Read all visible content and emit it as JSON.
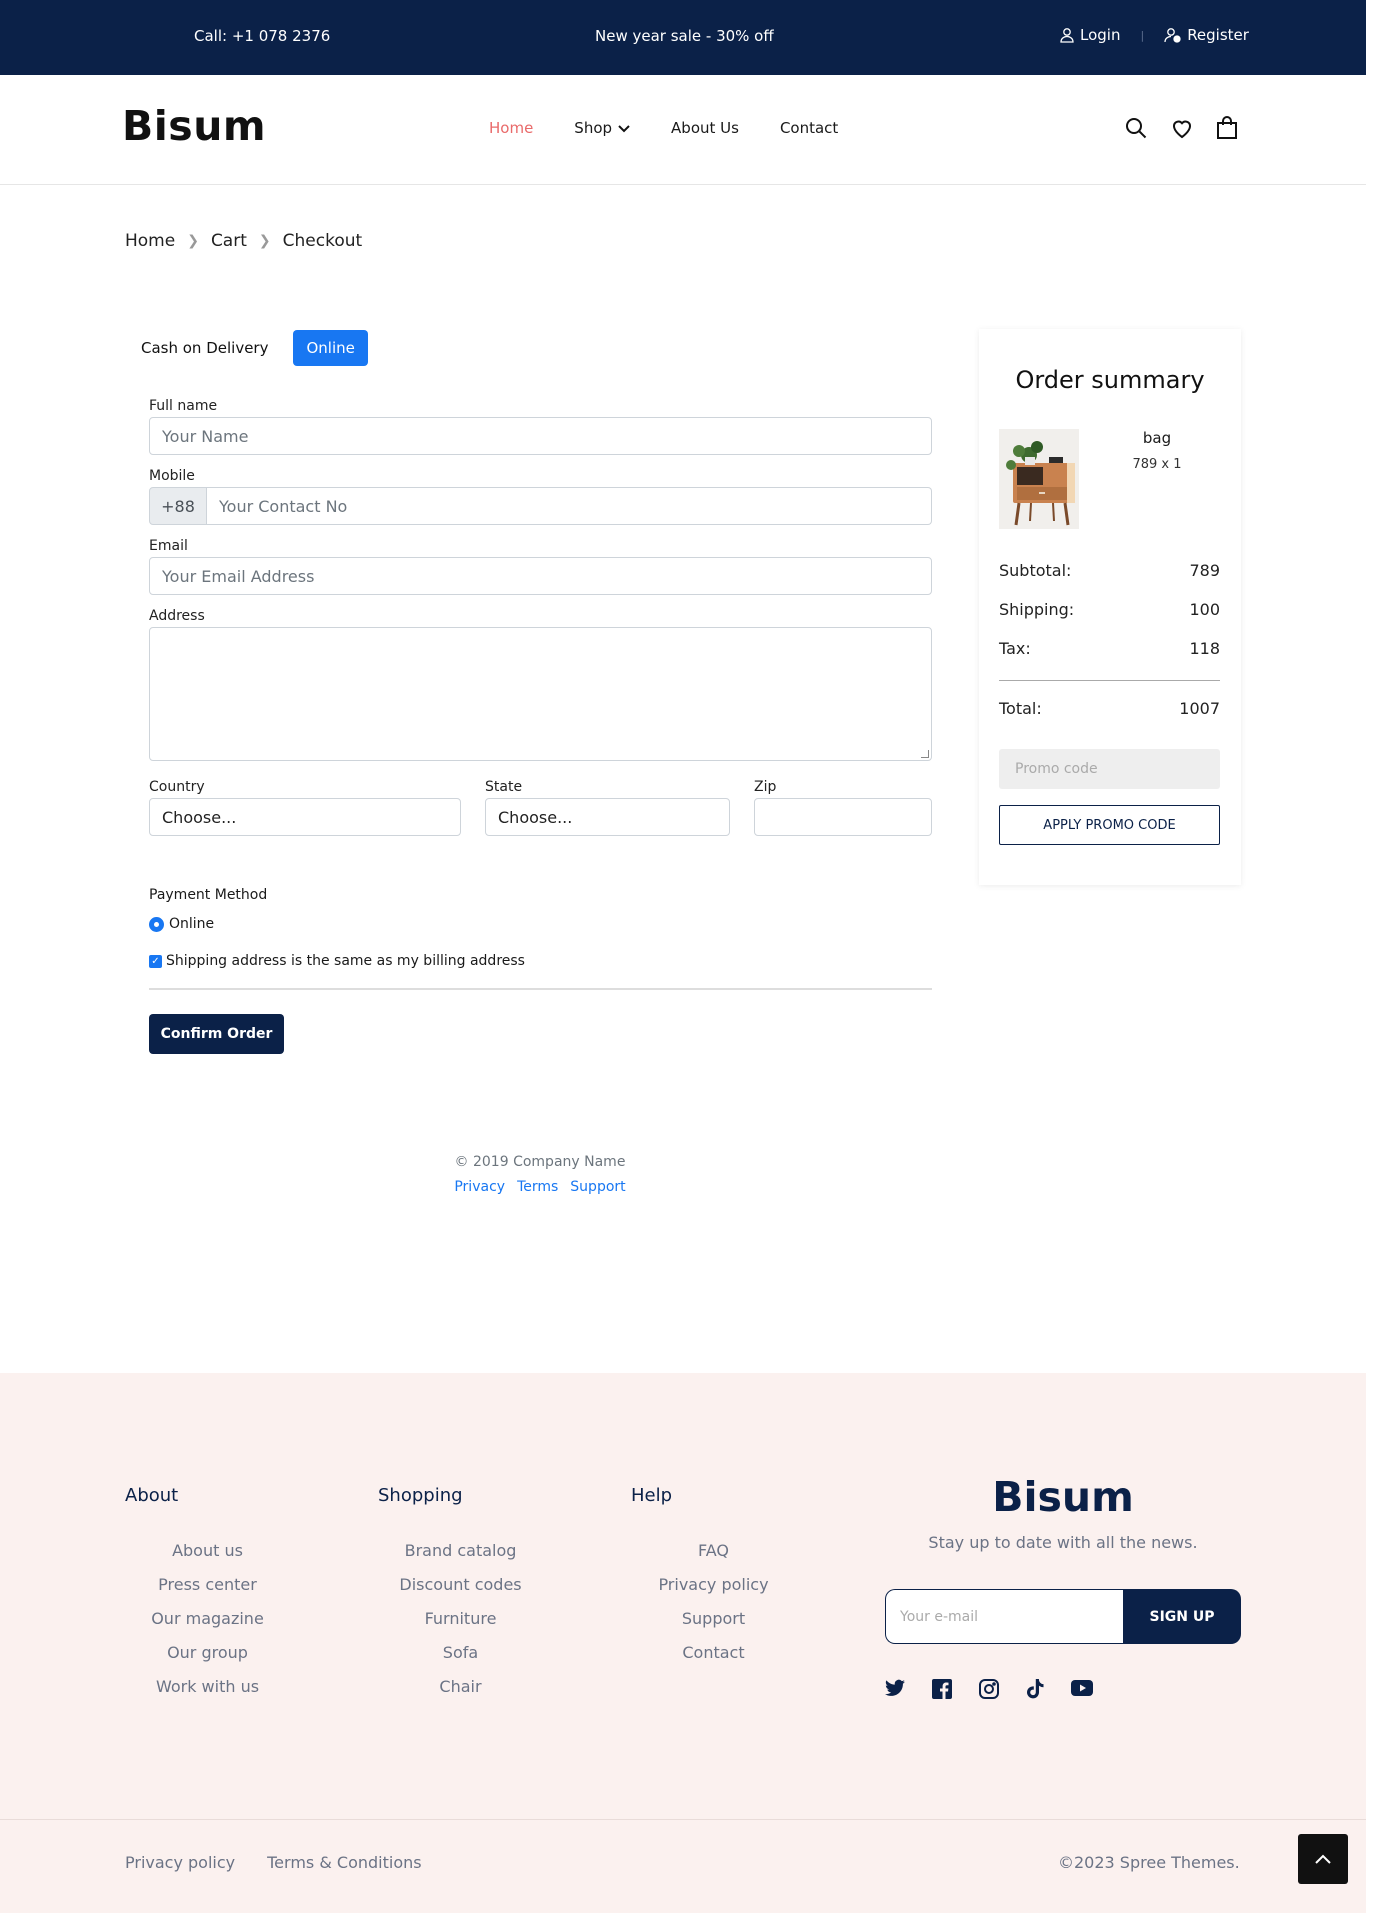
{
  "topbar": {
    "call": "Call: +1 078 2376",
    "sale": "New year sale - 30% off",
    "login": "Login",
    "register": "Register"
  },
  "header": {
    "logo": "Bisum",
    "nav": {
      "home": "Home",
      "shop": "Shop",
      "about": "About Us",
      "contact": "Contact"
    },
    "icons": [
      "search-icon",
      "heart-icon",
      "bag-icon"
    ]
  },
  "breadcrumb": {
    "home": "Home",
    "cart": "Cart",
    "checkout": "Checkout"
  },
  "payment_tabs": {
    "cod": "Cash on Delivery",
    "online": "Online",
    "selected": "Online"
  },
  "form": {
    "full_name": {
      "label": "Full name",
      "placeholder": "Your Name"
    },
    "mobile": {
      "label": "Mobile",
      "prefix": "+88",
      "placeholder": "Your Contact No"
    },
    "email": {
      "label": "Email",
      "placeholder": "Your Email Address"
    },
    "address": {
      "label": "Address",
      "value": ""
    },
    "country": {
      "label": "Country",
      "selected": "Choose..."
    },
    "state": {
      "label": "State",
      "selected": "Choose..."
    },
    "zip": {
      "label": "Zip",
      "value": ""
    },
    "payment_method": {
      "label": "Payment Method",
      "option": "Online",
      "checked": true
    },
    "same_address": {
      "label": "Shipping address is the same as my billing address",
      "checked": true
    },
    "confirm": "Confirm Order"
  },
  "mini_footer": {
    "copyright": "© 2019 Company Name",
    "privacy": "Privacy",
    "terms": "Terms",
    "support": "Support"
  },
  "summary": {
    "title": "Order summary",
    "product": {
      "name": "bag",
      "qty_text": "789 x 1"
    },
    "subtotal_label": "Subtotal:",
    "subtotal": "789",
    "shipping_label": "Shipping:",
    "shipping": "100",
    "tax_label": "Tax:",
    "tax": "118",
    "total_label": "Total:",
    "total": "1007",
    "promo_placeholder": "Promo code",
    "promo_button": "APPLY PROMO CODE"
  },
  "footer": {
    "about": {
      "title": "About",
      "items": [
        "About us",
        "Press center",
        "Our magazine",
        "Our group",
        "Work with us"
      ]
    },
    "shopping": {
      "title": "Shopping",
      "items": [
        "Brand catalog",
        "Discount codes",
        "Furniture",
        "Sofa",
        "Chair"
      ]
    },
    "help": {
      "title": "Help",
      "items": [
        "FAQ",
        "Privacy policy",
        "Support",
        "Contact"
      ]
    },
    "brand": "Bisum",
    "tagline": "Stay up to date with all the news.",
    "email_placeholder": "Your e-mail",
    "signup": "SIGN UP",
    "socials": [
      "twitter-icon",
      "facebook-icon",
      "instagram-icon",
      "tiktok-icon",
      "youtube-icon"
    ],
    "privacy_policy": "Privacy policy",
    "terms": "Terms & Conditions",
    "copyright": "©2023 Spree Themes."
  },
  "colors": {
    "navy": "#0b2148",
    "accent_blue": "#1877f2",
    "nav_active": "#e96a6a",
    "footer_bg": "#fbf1ef"
  }
}
